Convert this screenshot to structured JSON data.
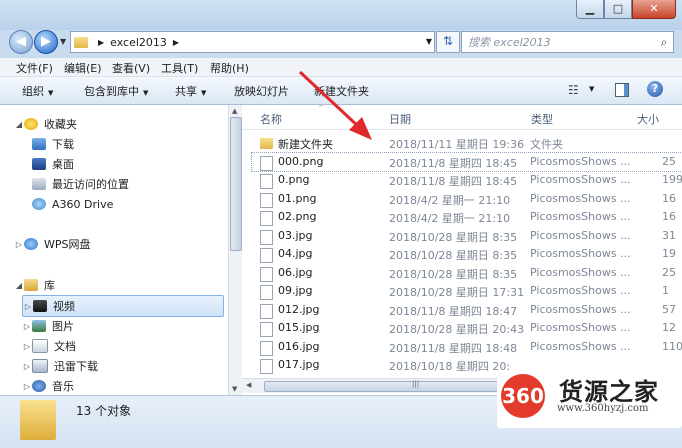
{
  "window": {
    "minimize": "▁",
    "maximize": "□",
    "close": "✕"
  },
  "nav": {
    "back_glyph": "◀",
    "forward_glyph": "▶",
    "breadcrumb_folder": "excel2013",
    "separator": "▶",
    "dropdown": "▼",
    "refresh_glyph": "⇅"
  },
  "search": {
    "placeholder": "搜索 excel2013",
    "icon": "search-icon"
  },
  "menubar": {
    "file": "文件(F)",
    "edit": "编辑(E)",
    "view": "查看(V)",
    "tools": "工具(T)",
    "help": "帮助(H)"
  },
  "toolbar": {
    "organize": "组织",
    "include_library": "包含到库中",
    "share": "共享",
    "slideshow": "放映幻灯片",
    "new_folder": "新建文件夹",
    "dropdown_glyph": "▼",
    "views_glyph": "☷",
    "help_glyph": "?"
  },
  "sidebar": {
    "favorites": "收藏夹",
    "downloads": "下载",
    "desktop": "桌面",
    "recent": "最近访问的位置",
    "a360": "A360 Drive",
    "wps": "WPS网盘",
    "libraries": "库",
    "videos": "视频",
    "pictures": "图片",
    "documents": "文档",
    "xunlei": "迅雷下载",
    "music": "音乐",
    "expand_glyph": "▷",
    "collapse_glyph": "◢"
  },
  "columns": {
    "name": "名称",
    "date": "日期",
    "type": "类型",
    "size": "大小",
    "sort_glyph": "^"
  },
  "files": [
    {
      "name": "新建文件夹",
      "date": "2018/11/11 星期日 19:36",
      "type": "文件夹",
      "size": ""
    },
    {
      "name": "000.png",
      "date": "2018/11/8 星期四 18:45",
      "type": "PicosmosShows ...",
      "size": "25"
    },
    {
      "name": "0.png",
      "date": "2018/11/8 星期四 18:45",
      "type": "PicosmosShows ...",
      "size": "199"
    },
    {
      "name": "01.png",
      "date": "2018/4/2 星期一 21:10",
      "type": "PicosmosShows ...",
      "size": "16"
    },
    {
      "name": "02.png",
      "date": "2018/4/2 星期一 21:10",
      "type": "PicosmosShows ...",
      "size": "16"
    },
    {
      "name": "03.jpg",
      "date": "2018/10/28 星期日 8:35",
      "type": "PicosmosShows ...",
      "size": "31"
    },
    {
      "name": "04.jpg",
      "date": "2018/10/28 星期日 8:35",
      "type": "PicosmosShows ...",
      "size": "19"
    },
    {
      "name": "06.jpg",
      "date": "2018/10/28 星期日 8:35",
      "type": "PicosmosShows ...",
      "size": "25"
    },
    {
      "name": "09.jpg",
      "date": "2018/10/28 星期日 17:31",
      "type": "PicosmosShows ...",
      "size": "1"
    },
    {
      "name": "012.jpg",
      "date": "2018/11/8 星期四 18:47",
      "type": "PicosmosShows ...",
      "size": "57"
    },
    {
      "name": "015.jpg",
      "date": "2018/10/28 星期日 20:43",
      "type": "PicosmosShows ...",
      "size": "12"
    },
    {
      "name": "016.jpg",
      "date": "2018/11/8 星期四 18:48",
      "type": "PicosmosShows ...",
      "size": "110"
    },
    {
      "name": "017.jpg",
      "date": "2018/10/18 星期四 20:",
      "type": "",
      "size": ""
    }
  ],
  "hscroll": {
    "left_glyph": "◀",
    "grip": "|||"
  },
  "status": {
    "count": "13 个对象"
  },
  "watermark": {
    "badge": "360",
    "title": "货源之家",
    "url": "www.360hyzj.com"
  },
  "colors": {
    "annotation_arrow": "#e02a2a",
    "watermark_red": "#e23b2c"
  }
}
